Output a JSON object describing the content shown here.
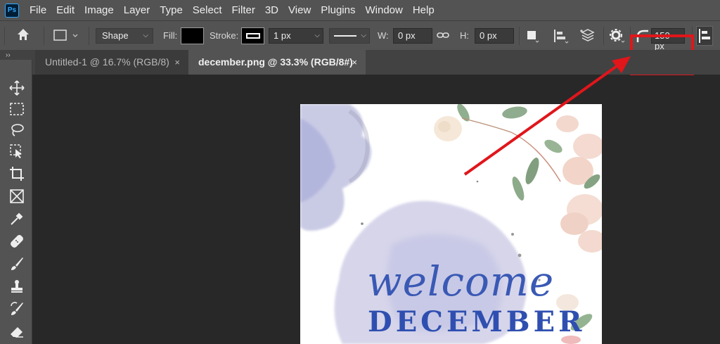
{
  "app": {
    "logo": "Ps"
  },
  "menu": [
    "File",
    "Edit",
    "Image",
    "Layer",
    "Type",
    "Select",
    "Filter",
    "3D",
    "View",
    "Plugins",
    "Window",
    "Help"
  ],
  "options": {
    "mode": "Shape",
    "fill_label": "Fill:",
    "fill_color": "#000000",
    "stroke_label": "Stroke:",
    "stroke_width": "1 px",
    "w_label": "W:",
    "w_value": "0 px",
    "h_label": "H:",
    "h_value": "0 px",
    "radius_value": "150 px"
  },
  "tabs": [
    {
      "label": "Untitled-1 @ 16.7% (RGB/8)",
      "close": "×"
    },
    {
      "label": "december.png @ 33.3% (RGB/8#)",
      "close": "×"
    }
  ],
  "tools": [
    "move-icon",
    "marquee-icon",
    "lasso-icon",
    "object-select-icon",
    "crop-icon",
    "frame-icon",
    "eyedropper-icon",
    "healing-icon",
    "brush-icon",
    "stamp-icon",
    "history-brush-icon",
    "eraser-icon"
  ],
  "canvas": {
    "script_text": "welcome",
    "title_text": "DECEMBER"
  },
  "colors": {
    "highlight": "#e0161b",
    "text_blue": "#2f4fb0"
  }
}
